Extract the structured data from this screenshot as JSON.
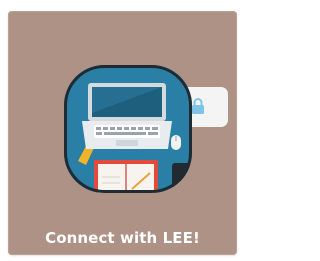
{
  "tile": {
    "label": "Connect with LEE!",
    "icon": "laptop-desk-icon",
    "badge_icon": "lock-icon"
  },
  "colors": {
    "tile_background": "#ad9285",
    "icon_background": "#2a7fa6",
    "icon_border": "#1f2a33",
    "label_text": "#ffffff",
    "lock_color": "#7fc3e8"
  }
}
